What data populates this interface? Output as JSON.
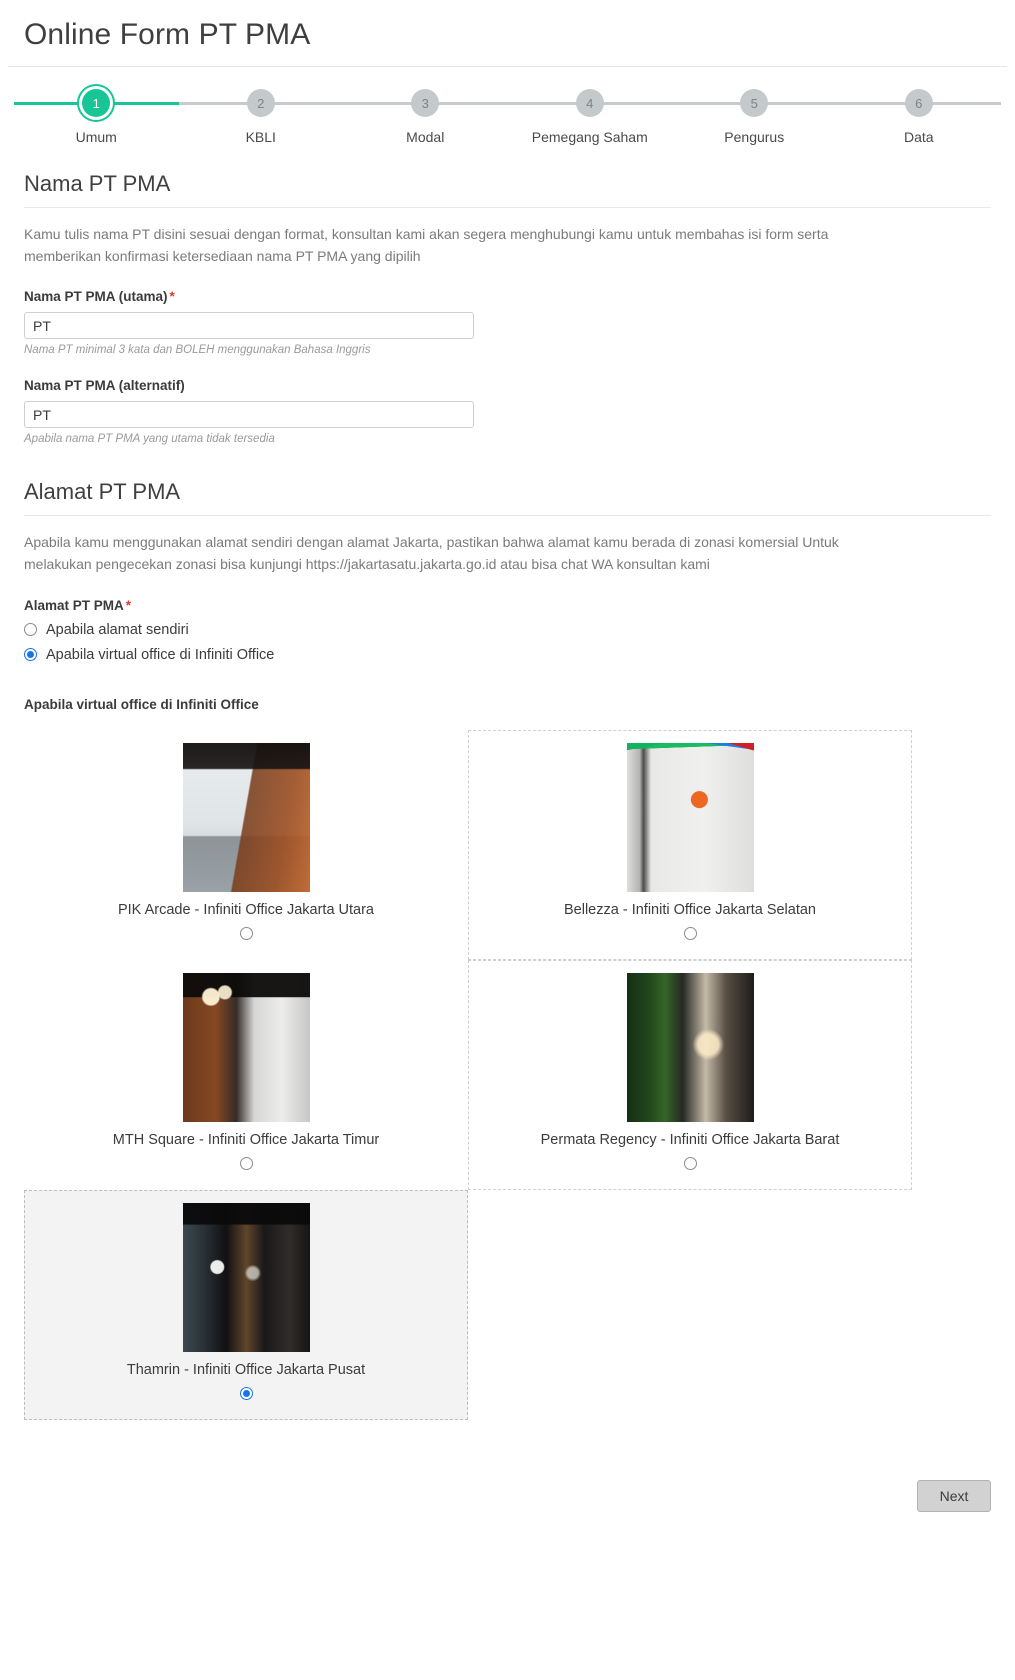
{
  "header": {
    "title": "Online Form PT PMA"
  },
  "stepper": {
    "current": 1,
    "active_color": "#17c595",
    "inactive_color": "#c4c9cb",
    "steps": [
      {
        "number": "1",
        "label": "Umum"
      },
      {
        "number": "2",
        "label": "KBLI"
      },
      {
        "number": "3",
        "label": "Modal"
      },
      {
        "number": "4",
        "label": "Pemegang Saham"
      },
      {
        "number": "5",
        "label": "Pengurus"
      },
      {
        "number": "6",
        "label": "Data"
      }
    ]
  },
  "nama_section": {
    "heading": "Nama PT PMA",
    "description": "Kamu tulis nama PT disini sesuai dengan format, konsultan kami akan segera menghubungi kamu untuk membahas isi form serta memberikan konfirmasi ketersediaan nama PT PMA yang dipilih",
    "fields": [
      {
        "label": "Nama PT PMA (utama)",
        "required": true,
        "required_marker": "*",
        "value": "PT",
        "placeholder": "",
        "hint": "Nama PT minimal 3 kata dan BOLEH menggunakan Bahasa Inggris"
      },
      {
        "label": "Nama PT PMA (alternatif)",
        "required": false,
        "required_marker": "",
        "value": "PT",
        "placeholder": "",
        "hint": "Apabila nama PT PMA yang utama tidak tersedia"
      }
    ]
  },
  "alamat_section": {
    "heading": "Alamat PT PMA",
    "description": "Apabila kamu menggunakan alamat sendiri dengan alamat Jakarta, pastikan bahwa alamat kamu berada di zonasi komersial Untuk melakukan pengecekan zonasi bisa kunjungi https://jakartasatu.jakarta.go.id atau bisa chat WA konsultan kami",
    "field_label": "Alamat PT PMA",
    "required_marker": "*",
    "options": [
      {
        "label": "Apabila alamat sendiri",
        "selected": false
      },
      {
        "label": "Apabila virtual office di Infiniti Office",
        "selected": true
      }
    ],
    "selected_accent": "#1773e8"
  },
  "virtual_office": {
    "group_label": "Apabila virtual office di Infiniti Office",
    "cards": [
      {
        "title": "PIK Arcade - Infiniti Office Jakarta Utara",
        "selected": false,
        "outlined": false,
        "image_name": "pik-arcade-lounge-photo"
      },
      {
        "title": "Bellezza - Infiniti Office Jakarta Selatan",
        "selected": false,
        "outlined": true,
        "image_name": "bellezza-corridor-photo"
      },
      {
        "title": "MTH Square - Infiniti Office Jakarta Timur",
        "selected": false,
        "outlined": false,
        "image_name": "mth-square-hallway-photo"
      },
      {
        "title": "Permata Regency - Infiniti Office Jakarta Barat",
        "selected": false,
        "outlined": true,
        "image_name": "permata-regency-green-wall-photo"
      },
      {
        "title": "Thamrin - Infiniti Office Jakarta Pusat",
        "selected": true,
        "outlined": true,
        "image_name": "thamrin-dark-interior-photo"
      }
    ]
  },
  "footer": {
    "next_label": "Next"
  }
}
